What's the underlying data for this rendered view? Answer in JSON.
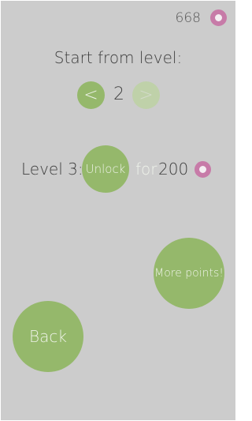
{
  "colors": {
    "background": "#cccccc",
    "accent_green": "#95b86b",
    "disabled_green": "#bfd1a9",
    "coin_pink": "#c77ba8"
  },
  "header": {
    "points": "668",
    "points_icon": "coin-icon"
  },
  "level_select": {
    "title": "Start from level:",
    "prev_label": "<",
    "current_level": "2",
    "next_label": ">",
    "next_enabled": false
  },
  "unlock": {
    "level_label": "Level 3:",
    "button_label": "Unlock",
    "for_label": "for",
    "cost": "200",
    "cost_icon": "coin-icon"
  },
  "more_points": {
    "label": "More points!"
  },
  "back": {
    "label": "Back"
  }
}
